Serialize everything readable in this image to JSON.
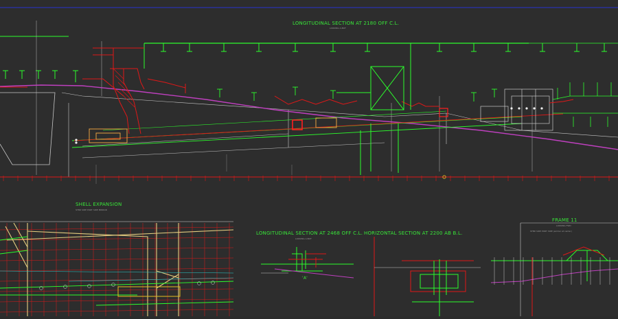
{
  "colors": {
    "background": "#2d2d2d",
    "title_green": "#39e639",
    "structure_green": "#2cff2c",
    "red_markup": "#e01818",
    "magenta_line": "#c040c0",
    "yellow_hull": "#e8d080",
    "cyan_lines": "#2ad0d0",
    "white_lines": "#d8d8d8",
    "top_border_blue": "#2a32b0"
  },
  "views": {
    "main_title": "LONGITUDINAL SECTION  AT 2180 OFF  C.L.",
    "main_subtitle": "LOOKING A.BOT",
    "shell_title": "SHELL EXPANSION",
    "shell_subtitle": "STBD SIDE   PORT SIDE MIRROR",
    "long2_title": "LONGITUDINAL SECTION AT 2468 OFF C.L.",
    "long2_subtitle": "LOOKING A.BOT",
    "horiz_title": "HORIZONTAL SECTION AT 2200 AB B.L.",
    "frame_title": "FRAME 11",
    "frame_subtitle": "LOOKING FWD",
    "frame_sub2": "STBD SIDE   PORT SIDE (similar at center)",
    "section_mark": "'A'"
  }
}
